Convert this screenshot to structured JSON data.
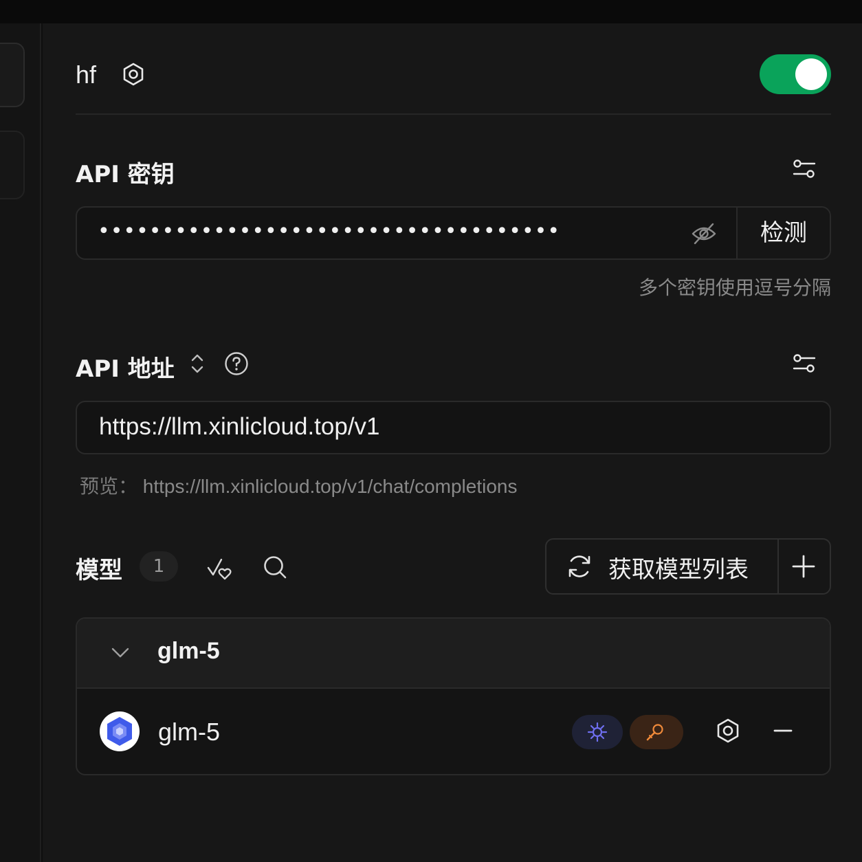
{
  "provider": {
    "name": "hf",
    "enabled": true,
    "toggle_color": "#0aa35a"
  },
  "api_key": {
    "title": "API 密钥",
    "masked_value": "••••••••••••••••••••••••••••••••••••",
    "check_label": "检测",
    "hint": "多个密钥使用逗号分隔"
  },
  "api_url": {
    "title": "API 地址",
    "value": "https://llm.xinlicloud.top/v1",
    "preview_label": "预览：",
    "preview_value": "https://llm.xinlicloud.top/v1/chat/completions"
  },
  "models": {
    "title": "模型",
    "count": "1",
    "fetch_label": "获取模型列表",
    "groups": [
      {
        "name": "glm-5",
        "items": [
          {
            "name": "glm-5",
            "capabilities": [
              "vision-icon",
              "tool-icon"
            ],
            "vision_color": "#6f6ff0",
            "tool_color": "#f08a3a"
          }
        ]
      }
    ]
  }
}
